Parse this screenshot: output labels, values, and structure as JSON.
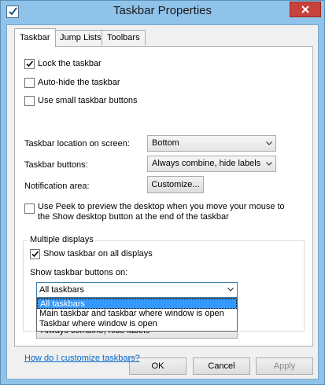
{
  "window": {
    "title": "Taskbar Properties"
  },
  "tabs": [
    {
      "label": "Taskbar"
    },
    {
      "label": "Jump Lists"
    },
    {
      "label": "Toolbars"
    }
  ],
  "taskbar": {
    "lock": {
      "label": "Lock the taskbar",
      "checked": true
    },
    "autohide": {
      "label": "Auto-hide the taskbar",
      "checked": false
    },
    "small_buttons": {
      "label": "Use small taskbar buttons",
      "checked": false
    },
    "location_label": "Taskbar location on screen:",
    "location_value": "Bottom",
    "buttons_label": "Taskbar buttons:",
    "buttons_value": "Always combine, hide labels",
    "notification_label": "Notification area:",
    "customize_label": "Customize...",
    "peek": {
      "label": "Use Peek to preview the desktop when you move your mouse to the Show desktop button at the end of the taskbar",
      "checked": false
    }
  },
  "multiple_displays": {
    "title": "Multiple displays",
    "show_all": {
      "label": "Show taskbar on all displays",
      "checked": true
    },
    "show_buttons_on_label": "Show taskbar buttons on:",
    "show_buttons_on_value": "All taskbars",
    "options": [
      "All taskbars",
      "Main taskbar and taskbar where window is open",
      "Taskbar where window is open"
    ],
    "selected_index": 0,
    "other_buttons_value": "Always combine, hide labels"
  },
  "help_link": "How do I customize taskbars?",
  "footer": {
    "ok": "OK",
    "cancel": "Cancel",
    "apply": "Apply"
  },
  "colors": {
    "titlebar": "#8fc3ea",
    "close": "#c7423a",
    "selection": "#3399ff",
    "link": "#0066cc"
  }
}
